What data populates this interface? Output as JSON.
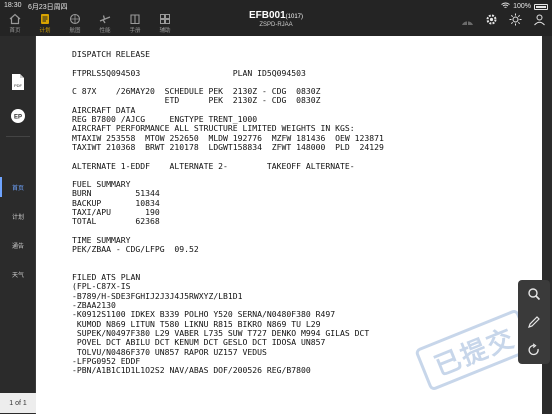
{
  "status": {
    "time": "18:30",
    "date": "6月23日周四",
    "battery": "100%"
  },
  "nav": [
    {
      "label": "首页",
      "icon": "home-icon"
    },
    {
      "label": "计划",
      "icon": "plan-icon"
    },
    {
      "label": "航图",
      "icon": "chart-icon"
    },
    {
      "label": "性能",
      "icon": "airplane-icon"
    },
    {
      "label": "手册",
      "icon": "manual-icon"
    },
    {
      "label": "辅助",
      "icon": "tools-icon"
    }
  ],
  "header": {
    "title": "EFB001",
    "title_suffix": "(1017)",
    "route": "ZSPD-RJAA"
  },
  "sidebar": {
    "tabs": [
      "首页",
      "计划",
      "通告",
      "天气"
    ],
    "active_tab": "首页",
    "pager": "1 of 1"
  },
  "document": {
    "lines": [
      "DISPATCH RELEASE",
      "",
      "FTPRLS5Q094503                   PLAN ID5Q094503",
      "",
      "C 87X    /26MAY20  SCHEDULE PEK  2130Z - CDG  0830Z",
      "                   ETD      PEK  2130Z - CDG  0830Z",
      "AIRCRAFT DATA",
      "REG B7800 /AJCG     ENGTYPE TRENT_1000",
      "AIRCRAFT PERFORMANCE ALL STRUCTURE LIMITED WEIGHTS IN KGS:",
      "MTAXIW 253558  MTOW 252650  MLDW 192776  MZFW 181436  OEW 123871",
      "TAXIWT 210368  BRWT 210178  LDGWT158834  ZFWT 148000  PLD  24129",
      "",
      "ALTERNATE 1-EDDF    ALTERNATE 2-        TAKEOFF ALTERNATE-",
      "",
      "FUEL SUMMARY",
      "BURN         51344",
      "BACKUP       10834",
      "TAXI/APU       190",
      "TOTAL        62368",
      "",
      "TIME SUMMARY",
      "PEK/ZBAA - CDG/LFPG  09.52",
      "",
      "",
      "FILED ATS PLAN",
      "(FPL-C87X-IS",
      "-B789/H-SDE3FGHIJ2J3J4J5RWXYZ/LB1D1",
      "-ZBAA2130",
      "-K0912S1100 IDKEX B339 POLHO Y520 SERNA/N0480F380 R497",
      " KUMOD N869 LITUN T580 LIKNU R815 BIKRO N869 TU L29",
      " SUPEK/N0497F380 L29 VABER L735 SUW T727 DENKO M994 GILAS DCT",
      " POVEL DCT ABILU DCT KENUM DCT GESLO DCT IDOSA UN857",
      " TOLVU/N0486F370 UN857 RAPOR UZ157 VEDUS",
      "-LFPG0952 EDDF",
      "-PBN/A1B1C1D1L1O2S2 NAV/ABAS DOF/200526 REG/B7800"
    ]
  },
  "stamp": {
    "text": "已提交",
    "color": "#9bb5d9"
  },
  "tools": [
    "search-icon",
    "pen-icon",
    "rotate-icon"
  ],
  "colors": {
    "accent": "#d9a400",
    "sidebar_active": "#6fa4ff"
  }
}
